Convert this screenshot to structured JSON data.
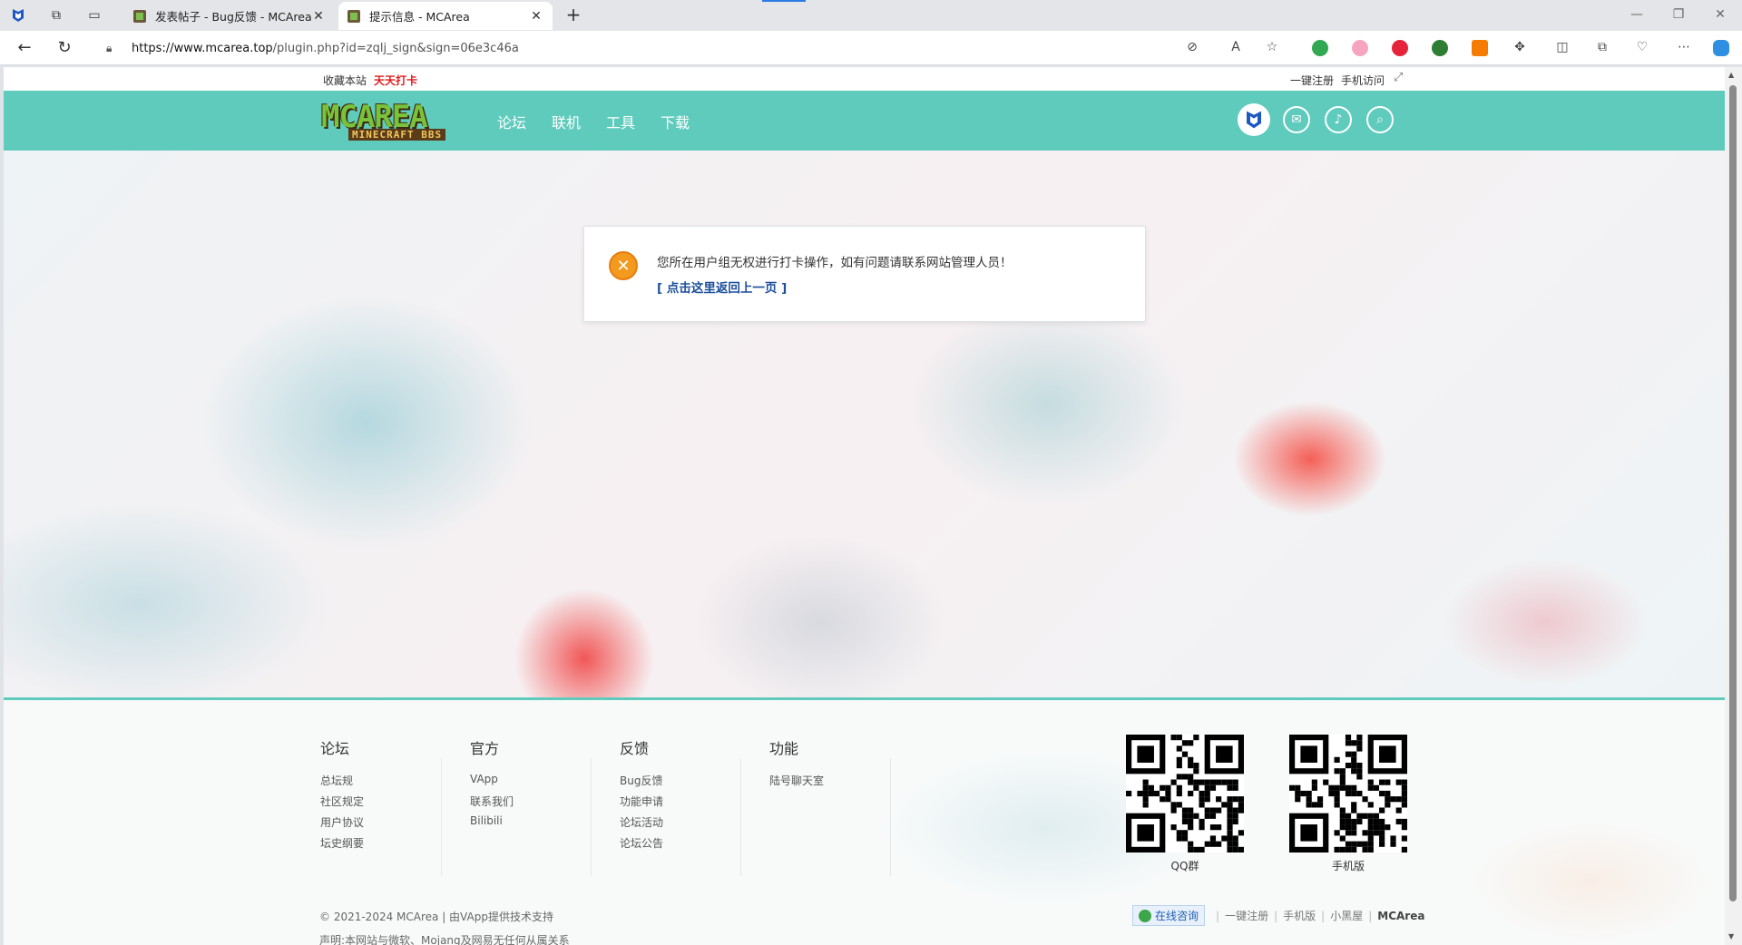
{
  "browser": {
    "tabs": [
      {
        "title": "发表帖子 - Bug反馈 - MCArea"
      },
      {
        "title": "提示信息 - MCArea"
      }
    ],
    "url_host": "https://www.mcarea.top",
    "url_path": "/plugin.php?id=zqlj_sign&sign=06e3c46a"
  },
  "topbar": {
    "favorite": "收藏本站",
    "sign": "天天打卡",
    "register": "一键注册",
    "mobile": "手机访问"
  },
  "header": {
    "logo_main": "MCAREA",
    "logo_sub": "MINECRAFT BBS",
    "menu": [
      "论坛",
      "联机",
      "工具",
      "下载"
    ]
  },
  "message": {
    "text": "您所在用户组无权进行打卡操作，如有问题请联系网站管理人员！",
    "link": "[ 点击这里返回上一页 ]"
  },
  "footer": {
    "columns": [
      {
        "title": "论坛",
        "items": [
          "总坛规",
          "社区规定",
          "用户协议",
          "坛史纲要"
        ]
      },
      {
        "title": "官方",
        "items": [
          "VApp",
          "联系我们",
          "Bilibili"
        ]
      },
      {
        "title": "反馈",
        "items": [
          "Bug反馈",
          "功能申请",
          "论坛活动",
          "论坛公告"
        ]
      },
      {
        "title": "功能",
        "items": [
          "陆号聊天室"
        ]
      }
    ],
    "qr": [
      {
        "caption": "QQ群"
      },
      {
        "caption": "手机版"
      }
    ],
    "copyright": "© 2021-2024 MCArea | 由VApp提供技术支持",
    "declaration": "声明:本网站与微软、Mojang及网易无任何从属关系",
    "online": "在线咨询",
    "links": [
      "一键注册",
      "手机版",
      "小黑屋"
    ],
    "brand": "MCArea"
  },
  "colors": {
    "header": "#5ecbbc",
    "sign_red": "#e01b1b",
    "link_blue": "#1c4f9b",
    "warn_orange": "#f39a1e"
  }
}
